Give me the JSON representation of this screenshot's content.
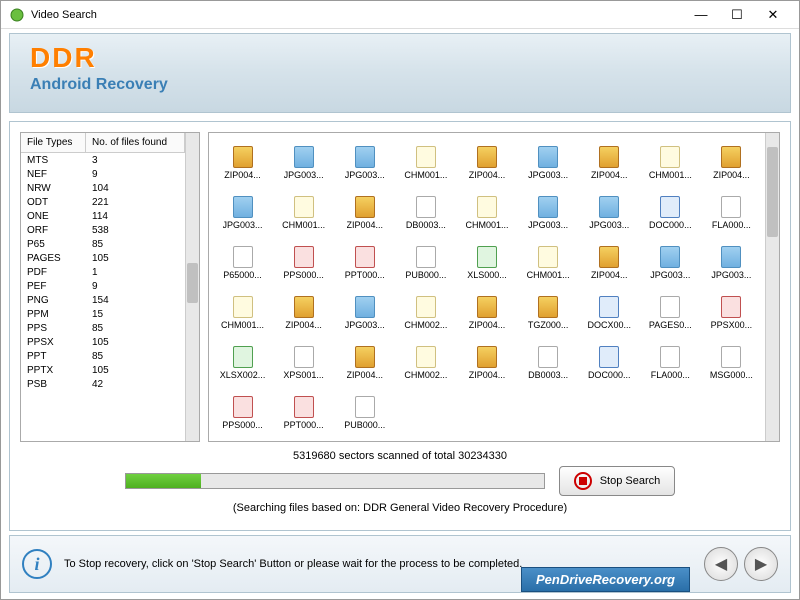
{
  "titlebar": {
    "title": "Video Search"
  },
  "header": {
    "logo": "DDR",
    "subtitle": "Android Recovery"
  },
  "file_table": {
    "col1": "File Types",
    "col2": "No. of files found",
    "rows": [
      {
        "t": "MTS",
        "n": "3"
      },
      {
        "t": "NEF",
        "n": "9"
      },
      {
        "t": "NRW",
        "n": "104"
      },
      {
        "t": "ODT",
        "n": "221"
      },
      {
        "t": "ONE",
        "n": "114"
      },
      {
        "t": "ORF",
        "n": "538"
      },
      {
        "t": "P65",
        "n": "85"
      },
      {
        "t": "PAGES",
        "n": "105"
      },
      {
        "t": "PDF",
        "n": "1"
      },
      {
        "t": "PEF",
        "n": "9"
      },
      {
        "t": "PNG",
        "n": "154"
      },
      {
        "t": "PPM",
        "n": "15"
      },
      {
        "t": "PPS",
        "n": "85"
      },
      {
        "t": "PPSX",
        "n": "105"
      },
      {
        "t": "PPT",
        "n": "85"
      },
      {
        "t": "PPTX",
        "n": "105"
      },
      {
        "t": "PSB",
        "n": "42"
      }
    ]
  },
  "files": [
    {
      "l": "ZIP004...",
      "c": "fi-zip"
    },
    {
      "l": "JPG003...",
      "c": "fi-img"
    },
    {
      "l": "JPG003...",
      "c": "fi-img"
    },
    {
      "l": "CHM001...",
      "c": "fi-chm"
    },
    {
      "l": "ZIP004...",
      "c": "fi-zip"
    },
    {
      "l": "JPG003...",
      "c": "fi-img"
    },
    {
      "l": "ZIP004...",
      "c": "fi-zip"
    },
    {
      "l": "CHM001...",
      "c": "fi-chm"
    },
    {
      "l": "ZIP004...",
      "c": "fi-zip"
    },
    {
      "l": "JPG003...",
      "c": "fi-img"
    },
    {
      "l": "CHM001...",
      "c": "fi-chm"
    },
    {
      "l": "ZIP004...",
      "c": "fi-zip"
    },
    {
      "l": "DB0003...",
      "c": "fi-gen"
    },
    {
      "l": "CHM001...",
      "c": "fi-chm"
    },
    {
      "l": "JPG003...",
      "c": "fi-img"
    },
    {
      "l": "JPG003...",
      "c": "fi-img"
    },
    {
      "l": "DOC000...",
      "c": "fi-doc"
    },
    {
      "l": "FLA000...",
      "c": "fi-gen"
    },
    {
      "l": "P65000...",
      "c": "fi-gen"
    },
    {
      "l": "PPS000...",
      "c": "fi-ppt"
    },
    {
      "l": "PPT000...",
      "c": "fi-ppt"
    },
    {
      "l": "PUB000...",
      "c": "fi-gen"
    },
    {
      "l": "XLS000...",
      "c": "fi-xls"
    },
    {
      "l": "CHM001...",
      "c": "fi-chm"
    },
    {
      "l": "ZIP004...",
      "c": "fi-zip"
    },
    {
      "l": "JPG003...",
      "c": "fi-img"
    },
    {
      "l": "JPG003...",
      "c": "fi-img"
    },
    {
      "l": "CHM001...",
      "c": "fi-chm"
    },
    {
      "l": "ZIP004...",
      "c": "fi-zip"
    },
    {
      "l": "JPG003...",
      "c": "fi-img"
    },
    {
      "l": "CHM002...",
      "c": "fi-chm"
    },
    {
      "l": "ZIP004...",
      "c": "fi-zip"
    },
    {
      "l": "TGZ000...",
      "c": "fi-zip"
    },
    {
      "l": "DOCX00...",
      "c": "fi-doc"
    },
    {
      "l": "PAGES0...",
      "c": "fi-gen"
    },
    {
      "l": "PPSX00...",
      "c": "fi-ppt"
    },
    {
      "l": "XLSX002...",
      "c": "fi-xls"
    },
    {
      "l": "XPS001...",
      "c": "fi-gen"
    },
    {
      "l": "ZIP004...",
      "c": "fi-zip"
    },
    {
      "l": "CHM002...",
      "c": "fi-chm"
    },
    {
      "l": "ZIP004...",
      "c": "fi-zip"
    },
    {
      "l": "DB0003...",
      "c": "fi-gen"
    },
    {
      "l": "DOC000...",
      "c": "fi-doc"
    },
    {
      "l": "FLA000...",
      "c": "fi-gen"
    },
    {
      "l": "MSG000...",
      "c": "fi-gen"
    },
    {
      "l": "PPS000...",
      "c": "fi-ppt"
    },
    {
      "l": "PPT000...",
      "c": "fi-ppt"
    },
    {
      "l": "PUB000...",
      "c": "fi-gen"
    }
  ],
  "progress": {
    "text": "5319680 sectors scanned of total 30234330",
    "note": "(Searching files based on:  DDR General Video Recovery Procedure)",
    "stop_label": "Stop Search"
  },
  "footer": {
    "text": "To Stop recovery, click on 'Stop Search' Button or please wait for the process to be completed.",
    "badge": "PenDriveRecovery.org"
  }
}
